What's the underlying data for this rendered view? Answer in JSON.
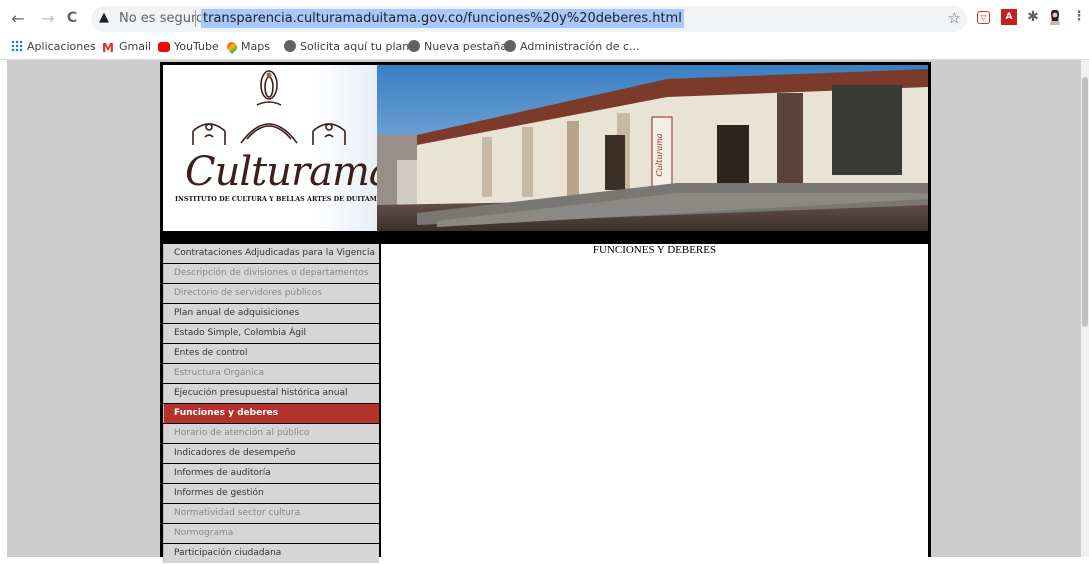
{
  "browser": {
    "back_icon": "←",
    "forward_icon": "→",
    "reload_icon": "C",
    "insecure_label": "No es seguro",
    "url": "transparencia.culturamaduitama.gov.co/funciones%20y%20deberes.html",
    "bookmarks": [
      {
        "label": "Aplicaciones",
        "icon": "apps-icon",
        "color": "#1a73e8"
      },
      {
        "label": "Gmail",
        "icon": "gmail-icon",
        "color": "#d93025"
      },
      {
        "label": "YouTube",
        "icon": "youtube-icon",
        "color": "#ff0000"
      },
      {
        "label": "Maps",
        "icon": "maps-icon",
        "color": "#34a853"
      },
      {
        "label": "Solicita aquí tu plan...",
        "icon": "globe-icon",
        "color": "#5f6368"
      },
      {
        "label": "Nueva pestaña",
        "icon": "globe-icon",
        "color": "#5f6368"
      },
      {
        "label": "Administración de c...",
        "icon": "globe-icon",
        "color": "#5f6368"
      }
    ]
  },
  "site": {
    "logo_text": "Culturama",
    "logo_subtitle": "INSTITUTO DE CULTURA Y BELLAS ARTES DE DUITAMA",
    "sign_text": "Culturama",
    "accent_color": "#b5322c"
  },
  "content": {
    "title": "FUNCIONES Y DEBERES"
  },
  "menu": [
    {
      "label": "Contrataciones Adjudicadas para la Vigencia",
      "style": "dark"
    },
    {
      "label": "Descripción de divisiones o departamentos",
      "style": "light"
    },
    {
      "label": "Directorio de servidores públicos",
      "style": "light"
    },
    {
      "label": "Plan anual de adquisiciones",
      "style": "dark"
    },
    {
      "label": "Estado Simple, Colombia Ágil",
      "style": "dark"
    },
    {
      "label": "Entes de control",
      "style": "dark"
    },
    {
      "label": "Estructura Orgánica",
      "style": "light"
    },
    {
      "label": "Ejecución presupuestal histórica anual",
      "style": "dark"
    },
    {
      "label": "Funciones y deberes",
      "style": "active"
    },
    {
      "label": "Horario de atención al público",
      "style": "light"
    },
    {
      "label": "Indicadores de desempeño",
      "style": "dark"
    },
    {
      "label": "Informes de auditoría",
      "style": "dark"
    },
    {
      "label": "Informes de gestión",
      "style": "dark"
    },
    {
      "label": "Normatividad sector cultura",
      "style": "light"
    },
    {
      "label": "Normograma",
      "style": "light"
    },
    {
      "label": "Participación ciudadana",
      "style": "dark"
    }
  ]
}
